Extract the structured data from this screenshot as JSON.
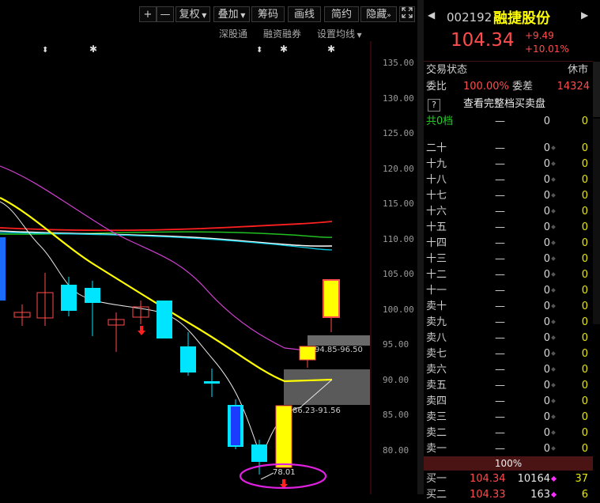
{
  "toolbar": {
    "plus": "+",
    "minus": "—",
    "fuquan": "复权",
    "diejia": "叠加",
    "chouma": "筹码",
    "huaxian": "画线",
    "jianyue": "简约",
    "yincang": "隐藏",
    "expand_icon": "expand-icon"
  },
  "subbar": {
    "shengutong": "深股通",
    "rongzi": "融资融券",
    "junxian": "设置均线"
  },
  "price_axis": [
    "135.00",
    "130.00",
    "125.00",
    "120.00",
    "115.00",
    "110.00",
    "105.00",
    "100.00",
    "95.00",
    "90.00",
    "85.00",
    "80.00"
  ],
  "annotations": {
    "low_price": "78.01",
    "zone_upper": "94.85-96.50",
    "zone_lower": "86.23-91.56"
  },
  "header": {
    "code": "002192",
    "name": "融捷股份",
    "price": "104.34",
    "change": "+9.49",
    "change_pct": "+10.01%"
  },
  "status": {
    "label": "交易状态",
    "value": "休市",
    "weibi_label": "委比",
    "weibi_value": "100.00%",
    "weicha_label": "委差",
    "weicha_value": "14324",
    "help": "?",
    "full_book": "查看完整档买卖盘",
    "total_label": "共0档",
    "total_dash": "—",
    "total_q1": "0",
    "total_q2": "0"
  },
  "book": [
    {
      "label": "二十",
      "dash": "—",
      "q": "0",
      "n": "0"
    },
    {
      "label": "十九",
      "dash": "—",
      "q": "0",
      "n": "0"
    },
    {
      "label": "十八",
      "dash": "—",
      "q": "0",
      "n": "0"
    },
    {
      "label": "十七",
      "dash": "—",
      "q": "0",
      "n": "0"
    },
    {
      "label": "十六",
      "dash": "—",
      "q": "0",
      "n": "0"
    },
    {
      "label": "十五",
      "dash": "—",
      "q": "0",
      "n": "0"
    },
    {
      "label": "十四",
      "dash": "—",
      "q": "0",
      "n": "0"
    },
    {
      "label": "十三",
      "dash": "—",
      "q": "0",
      "n": "0"
    },
    {
      "label": "十二",
      "dash": "—",
      "q": "0",
      "n": "0"
    },
    {
      "label": "十一",
      "dash": "—",
      "q": "0",
      "n": "0"
    },
    {
      "label": "卖十",
      "dash": "—",
      "q": "0",
      "n": "0"
    },
    {
      "label": "卖九",
      "dash": "—",
      "q": "0",
      "n": "0"
    },
    {
      "label": "卖八",
      "dash": "—",
      "q": "0",
      "n": "0"
    },
    {
      "label": "卖七",
      "dash": "—",
      "q": "0",
      "n": "0"
    },
    {
      "label": "卖六",
      "dash": "—",
      "q": "0",
      "n": "0"
    },
    {
      "label": "卖五",
      "dash": "—",
      "q": "0",
      "n": "0"
    },
    {
      "label": "卖四",
      "dash": "—",
      "q": "0",
      "n": "0"
    },
    {
      "label": "卖三",
      "dash": "—",
      "q": "0",
      "n": "0"
    },
    {
      "label": "卖二",
      "dash": "—",
      "q": "0",
      "n": "0"
    },
    {
      "label": "卖一",
      "dash": "—",
      "q": "0",
      "n": "0"
    }
  ],
  "bar": {
    "value": "100%"
  },
  "buy": [
    {
      "label": "买一",
      "price": "104.34",
      "q": "10164",
      "n": "37"
    },
    {
      "label": "买二",
      "price": "104.33",
      "q": "163",
      "n": "6"
    }
  ],
  "colors": {
    "up": "#ff4c4c",
    "yellow": "#ffff00",
    "cyan": "#00e5ff",
    "blue": "#1a4cff",
    "magenta": "#d040d0"
  }
}
